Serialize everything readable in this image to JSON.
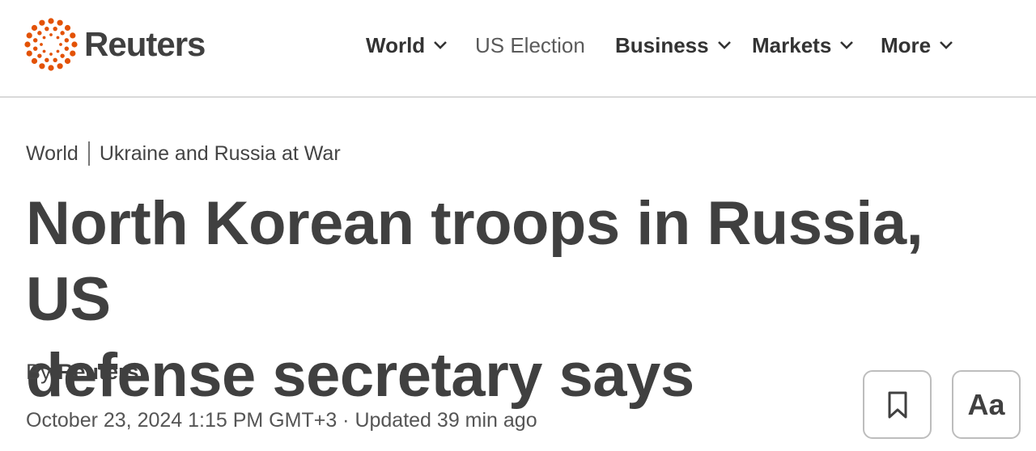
{
  "header": {
    "logo_text": "Reuters",
    "brand_color": "#e35205",
    "nav": [
      {
        "label": "World",
        "has_dropdown": true,
        "icon": "chevron-down-icon"
      },
      {
        "label": "US Election",
        "has_dropdown": false
      },
      {
        "label": "Business",
        "has_dropdown": true,
        "icon": "chevron-down-icon"
      },
      {
        "label": "Markets",
        "has_dropdown": true,
        "icon": "chevron-down-icon"
      },
      {
        "label": "More",
        "has_dropdown": true,
        "icon": "chevron-down-icon"
      }
    ]
  },
  "article": {
    "breadcrumb": [
      "World",
      "Ukraine and Russia at War"
    ],
    "headline_line1": "North Korean troops in Russia, US",
    "headline_line2": "defense secretary says",
    "byline_prefix": "By",
    "author": "Reuters",
    "dateline": "October 23, 2024 1:15 PM GMT+3 · Updated 39 min ago"
  },
  "tools": {
    "bookmark_icon": "bookmark-icon",
    "text_size_label": "Aa"
  }
}
